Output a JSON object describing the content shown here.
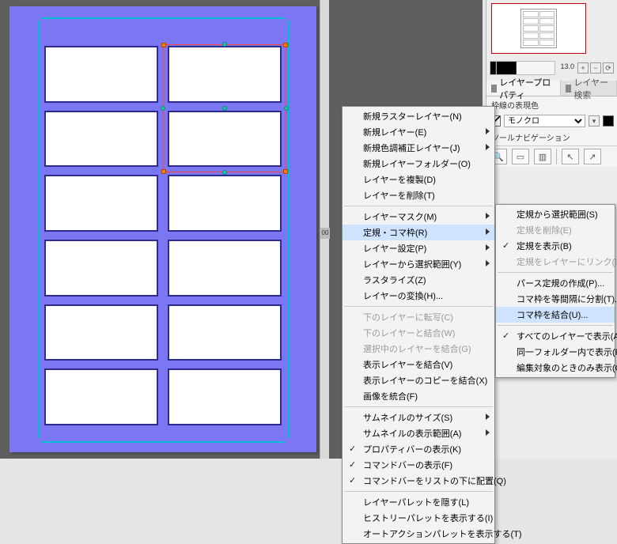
{
  "ruler": {
    "tick": "00"
  },
  "dock": {
    "brush_size": "13.0",
    "tabs": {
      "layer_property": "レイヤープロパティ",
      "layer_search": "レイヤー検索"
    },
    "border_section": "枠線の表現色",
    "mode_select": "モノクロ",
    "tool_nav_label": "ツールナビゲーション"
  },
  "menu1": {
    "items": [
      {
        "label": "新規ラスターレイヤー(N)",
        "sub": false
      },
      {
        "label": "新規レイヤー(E)",
        "sub": true
      },
      {
        "label": "新規色調補正レイヤー(J)",
        "sub": true
      },
      {
        "label": "新規レイヤーフォルダー(O)",
        "sub": false
      },
      {
        "label": "レイヤーを複製(D)",
        "sub": false
      },
      {
        "label": "レイヤーを削除(T)",
        "sub": false
      }
    ],
    "items2": [
      {
        "label": "レイヤーマスク(M)",
        "sub": true
      },
      {
        "label": "定規・コマ枠(R)",
        "sub": true,
        "hl": true
      },
      {
        "label": "レイヤー設定(P)",
        "sub": true
      },
      {
        "label": "レイヤーから選択範囲(Y)",
        "sub": true
      },
      {
        "label": "ラスタライズ(Z)",
        "sub": false
      },
      {
        "label": "レイヤーの変換(H)...",
        "sub": false
      }
    ],
    "items3": [
      {
        "label": "下のレイヤーに転写(C)",
        "dis": true
      },
      {
        "label": "下のレイヤーと結合(W)",
        "dis": true
      },
      {
        "label": "選択中のレイヤーを結合(G)",
        "dis": true
      },
      {
        "label": "表示レイヤーを結合(V)",
        "sub": false
      },
      {
        "label": "表示レイヤーのコピーを結合(X)",
        "sub": false
      },
      {
        "label": "画像を統合(F)",
        "sub": false
      }
    ],
    "items4": [
      {
        "label": "サムネイルのサイズ(S)",
        "sub": true
      },
      {
        "label": "サムネイルの表示範囲(A)",
        "sub": true
      },
      {
        "label": "プロパティバーの表示(K)",
        "check": true
      },
      {
        "label": "コマンドバーの表示(F)",
        "check": true
      },
      {
        "label": "コマンドバーをリストの下に配置(Q)",
        "check": true
      }
    ],
    "items5": [
      {
        "label": "レイヤーパレットを隠す(L)"
      },
      {
        "label": "ヒストリーパレットを表示する(I)"
      },
      {
        "label": "オートアクションパレットを表示する(T)"
      }
    ]
  },
  "menu2": {
    "g1": [
      {
        "label": "定規から選択範囲(S)"
      },
      {
        "label": "定規を削除(E)",
        "dis": true
      },
      {
        "label": "定規を表示(B)",
        "check": true
      },
      {
        "label": "定規をレイヤーにリンク(L)",
        "dis": true
      }
    ],
    "g2": [
      {
        "label": "パース定規の作成(P)..."
      },
      {
        "label": "コマ枠を等間隔に分割(T)..."
      },
      {
        "label": "コマ枠を結合(U)...",
        "hl": true
      }
    ],
    "g3": [
      {
        "label": "すべてのレイヤーで表示(A)",
        "check": true
      },
      {
        "label": "同一フォルダー内で表示(F)"
      },
      {
        "label": "編集対象のときのみ表示(O)"
      }
    ]
  }
}
